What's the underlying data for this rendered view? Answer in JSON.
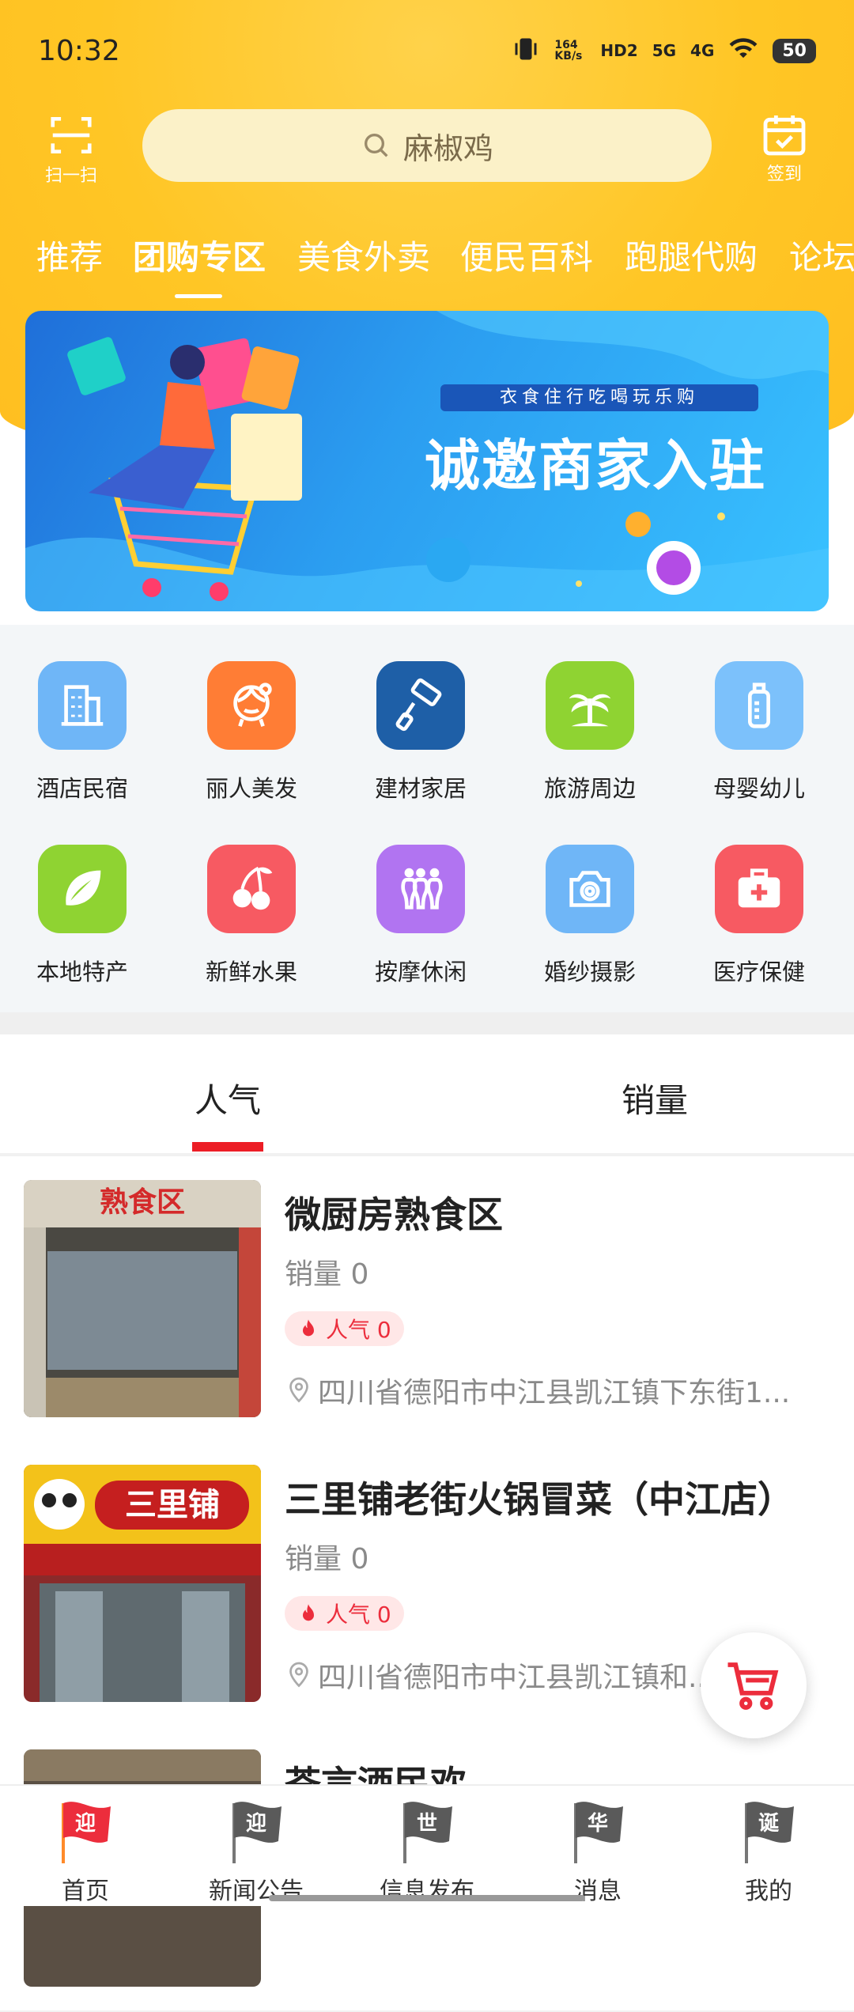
{
  "status_bar": {
    "time": "10:32",
    "net_speed": "164 KB/s",
    "hd": "HD2",
    "sig1": "5G",
    "sig2": "4G",
    "battery": "50"
  },
  "header": {
    "scan_label": "扫一扫",
    "search_text": "麻椒鸡",
    "checkin_label": "签到"
  },
  "tabs": [
    "推荐",
    "团购专区",
    "美食外卖",
    "便民百科",
    "跑腿代购",
    "论坛"
  ],
  "banner": {
    "tag": "衣食住行吃喝玩乐购",
    "title": "诚邀商家入驻"
  },
  "categories": [
    {
      "label": "酒店民宿",
      "icon": "building-icon",
      "color": "#6fb6f7"
    },
    {
      "label": "丽人美发",
      "icon": "beauty-icon",
      "color": "#ff7d35"
    },
    {
      "label": "建材家居",
      "icon": "roller-icon",
      "color": "#1e5fa7"
    },
    {
      "label": "旅游周边",
      "icon": "palm-tree-icon",
      "color": "#8fd332"
    },
    {
      "label": "母婴幼儿",
      "icon": "baby-bottle-icon",
      "color": "#7cc1fb"
    },
    {
      "label": "本地特产",
      "icon": "leaf-icon",
      "color": "#8fd332"
    },
    {
      "label": "新鲜水果",
      "icon": "cherry-icon",
      "color": "#f75a62"
    },
    {
      "label": "按摩休闲",
      "icon": "massage-icon",
      "color": "#b174f1"
    },
    {
      "label": "婚纱摄影",
      "icon": "camera-icon",
      "color": "#6fb6f7"
    },
    {
      "label": "医疗保健",
      "icon": "medkit-icon",
      "color": "#f75a62"
    }
  ],
  "sort_tabs": [
    "人气",
    "销量"
  ],
  "listings": [
    {
      "title": "微厨房熟食区",
      "sales": "销量 0",
      "popularity": "人气 0",
      "address": "四川省德阳市中江县凯江镇下东街1..."
    },
    {
      "title": "三里铺老街火锅冒菜（中江店）",
      "sales": "销量 0",
      "popularity": "人气 0",
      "address": "四川省德阳市中江县凯江镇和..."
    },
    {
      "title": "苍言酒民欢"
    }
  ],
  "signage": {
    "shop1": "熟食区",
    "shop2": "三里铺"
  },
  "bottom_nav": [
    {
      "label": "首页",
      "badge": "迎",
      "active": true
    },
    {
      "label": "新闻公告",
      "badge": "迎"
    },
    {
      "label": "信息发布",
      "badge": "世"
    },
    {
      "label": "消息",
      "badge": "华"
    },
    {
      "label": "我的",
      "badge": "诞"
    }
  ],
  "colors": {
    "header": "#ffc625",
    "accent": "#ec1d25"
  }
}
